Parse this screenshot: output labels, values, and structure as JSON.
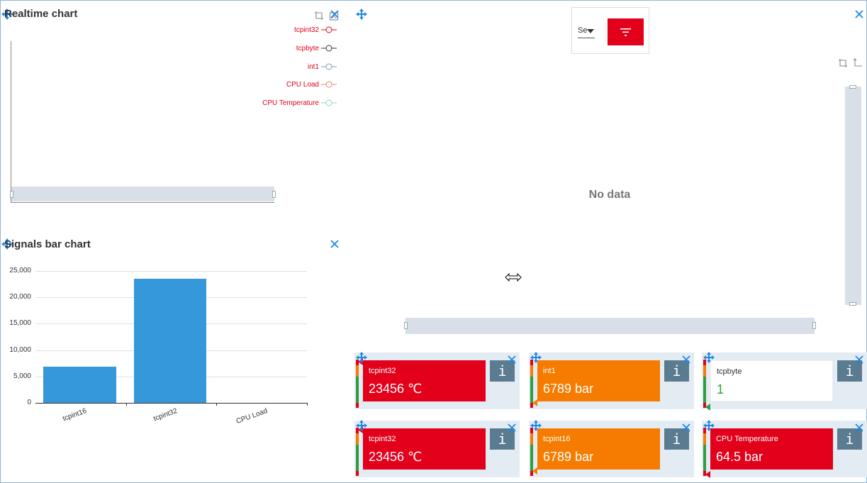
{
  "realtime_chart": {
    "title": "Realtime chart",
    "legend": [
      {
        "name": "tcpint32",
        "color": "#e3001b"
      },
      {
        "name": "tcpbyte",
        "color": "#333333"
      },
      {
        "name": "int1",
        "color": "#7a9cb0"
      },
      {
        "name": "CPU Load",
        "color": "#e8836f"
      },
      {
        "name": "CPU Temperature",
        "color": "#8fd3c7"
      }
    ]
  },
  "filter_panel": {
    "select_value": "Se",
    "empty_text": "No data"
  },
  "bar_chart_panel": {
    "title": "Signals bar chart"
  },
  "chart_data": {
    "type": "bar",
    "categories": [
      "tcpint16",
      "tcpint32",
      "CPU Load"
    ],
    "values": [
      6789,
      23456,
      0
    ],
    "ylim": [
      0,
      25000
    ],
    "yticks": [
      "0",
      "5,000",
      "10,000",
      "15,000",
      "20,000",
      "25,000"
    ],
    "color": "#3498db",
    "grid": true
  },
  "tiles": [
    {
      "label": "tcpint32",
      "value": "23456 ℃",
      "bg": "#e3001b",
      "fg": "#ffffff",
      "pointer_color": "#e3001b",
      "level": 0.95
    },
    {
      "label": "int1",
      "value": "6789 bar",
      "bg": "#f57c00",
      "fg": "#ffffff",
      "pointer_color": "#f57c00",
      "level": 0.1
    },
    {
      "label": "tcpbyte",
      "value": "1",
      "bg": "#ffffff",
      "fg": "#2e9e3e",
      "label_color": "#333333",
      "pointer_color": "#2e9e3e",
      "level": 0.02
    },
    {
      "label": "tcpint32",
      "value": "23456 ℃",
      "bg": "#e3001b",
      "fg": "#ffffff",
      "pointer_color": "#e3001b",
      "level": 0.95
    },
    {
      "label": "tcpint16",
      "value": "6789 bar",
      "bg": "#f57c00",
      "fg": "#ffffff",
      "pointer_color": "#f57c00",
      "level": 0.1
    },
    {
      "label": "CPU Temperature",
      "value": "64.5 bar",
      "bg": "#e3001b",
      "fg": "#ffffff",
      "pointer_color": "#e3001b",
      "level": 0.03
    }
  ],
  "info_label": "i",
  "colors": {
    "accent": "#e3001b",
    "icon_blue": "#1e88e5",
    "scrollbar": "#d8dfe8"
  }
}
